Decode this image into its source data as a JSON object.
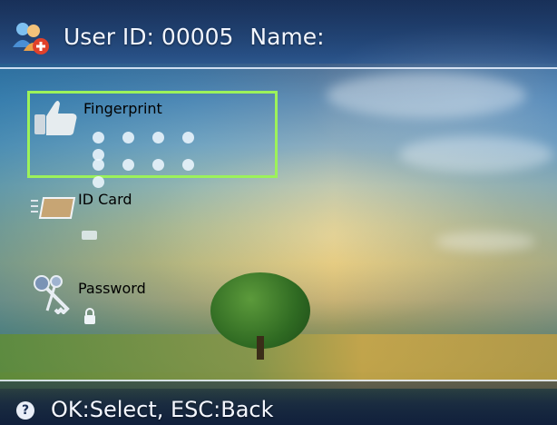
{
  "header": {
    "user_id_label": "User ID: 00005",
    "name_label": "Name:",
    "icon": "user-add-icon"
  },
  "menu": {
    "items": [
      {
        "label": "Fingerprint",
        "icon": "thumbs-up-icon",
        "selected": true
      },
      {
        "label": "ID Card",
        "icon": "id-card-icon",
        "selected": false
      },
      {
        "label": "Password",
        "icon": "keys-icon",
        "selected": false
      }
    ],
    "selection_color": "#9cf25a"
  },
  "footer": {
    "hint": "OK:Select, ESC:Back",
    "icon": "info-icon"
  }
}
